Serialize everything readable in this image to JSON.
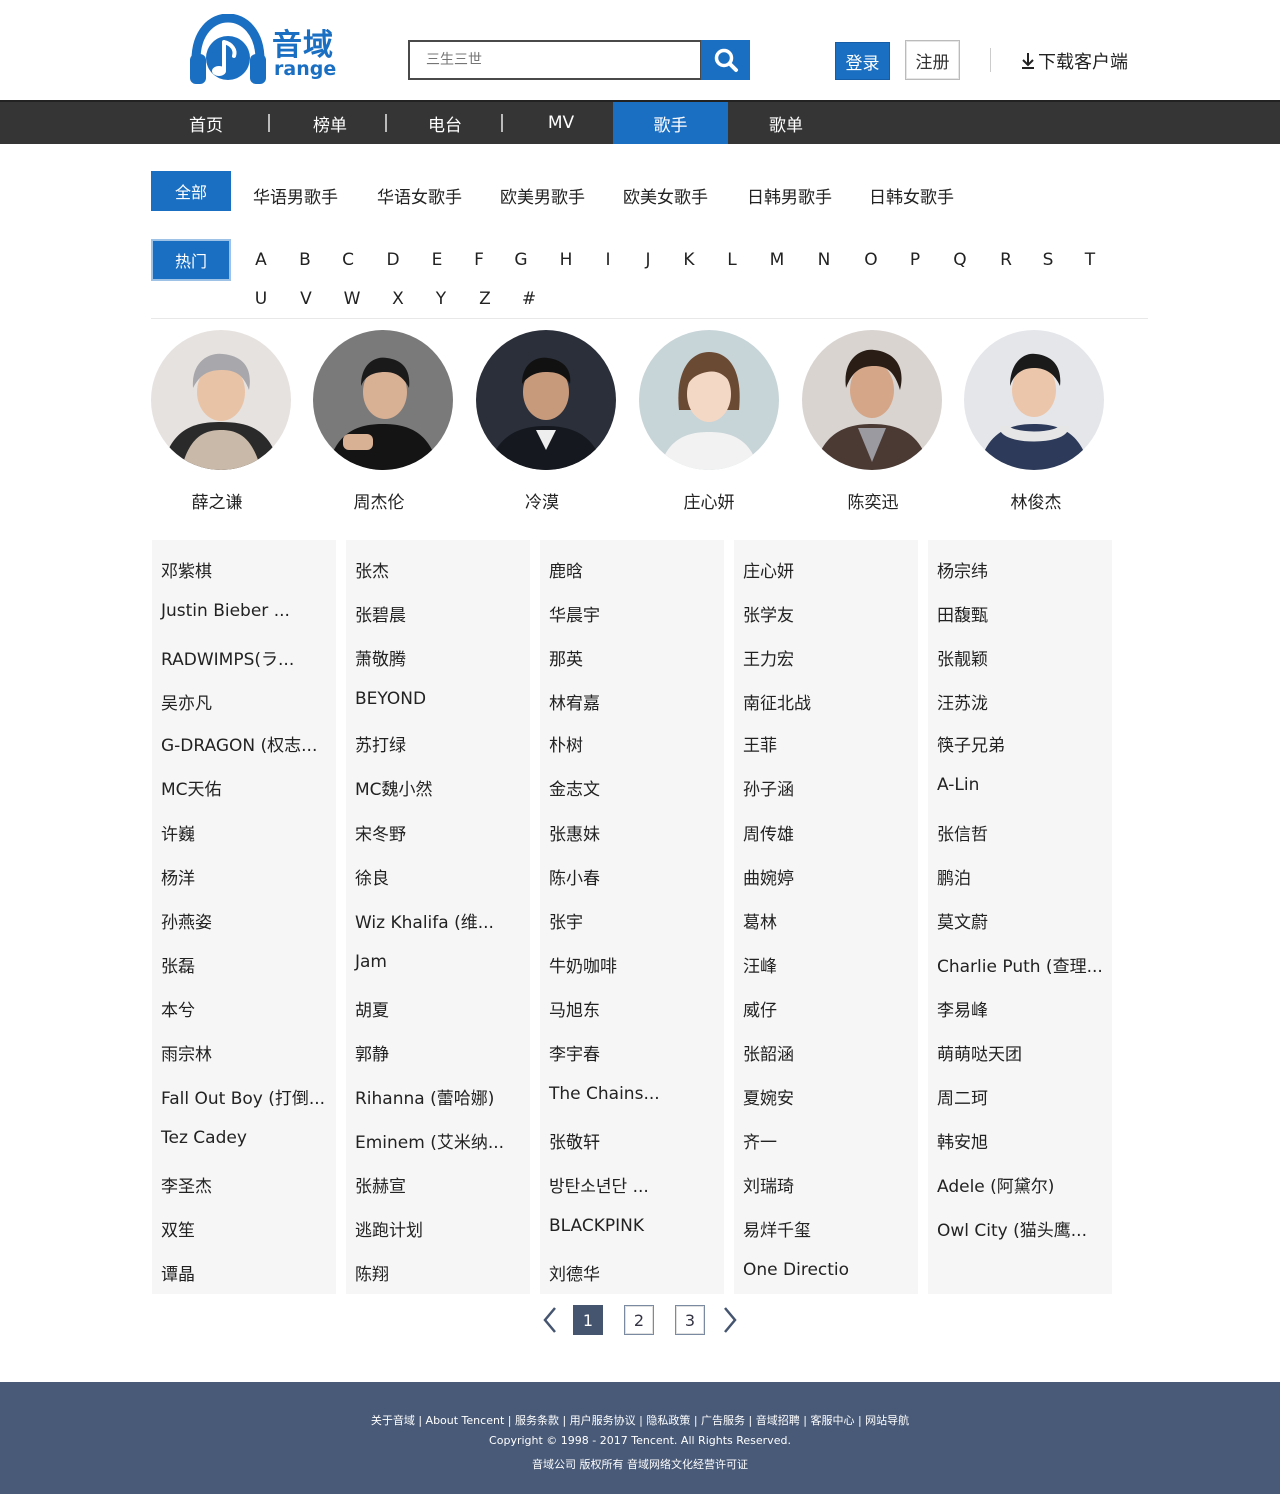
{
  "brand": {
    "name": "音域",
    "sub": "range",
    "colors": {
      "primary": "#1b6fc2",
      "nav": "#353535",
      "footer": "#485a78"
    }
  },
  "search": {
    "placeholder": "三生三世",
    "icon": "search-icon"
  },
  "auth": {
    "login": "登录",
    "register": "注册"
  },
  "download": {
    "label": "下载客户端",
    "icon": "download-icon"
  },
  "nav": {
    "items": [
      {
        "label": "首页"
      },
      {
        "label": "榜单"
      },
      {
        "label": "电台"
      },
      {
        "label": "MV"
      },
      {
        "label": "歌手",
        "active": true
      },
      {
        "label": "歌单"
      }
    ]
  },
  "categories": {
    "active": "全部",
    "items": [
      "华语男歌手",
      "华语女歌手",
      "欧美男歌手",
      "欧美女歌手",
      "日韩男歌手",
      "日韩女歌手"
    ]
  },
  "letters": {
    "hot": "热门",
    "row1": [
      "A",
      "B",
      "C",
      "D",
      "E",
      "F",
      "G",
      "H",
      "I",
      "J",
      "K",
      "L",
      "M",
      "N",
      "O",
      "P",
      "Q",
      "R",
      "S",
      "T"
    ],
    "row2": [
      "U",
      "V",
      "W",
      "X",
      "Y",
      "Z",
      "#"
    ]
  },
  "featured": [
    {
      "name": "薛之谦"
    },
    {
      "name": "周杰伦"
    },
    {
      "name": "冷漠"
    },
    {
      "name": "庄心妍"
    },
    {
      "name": "陈奕迅"
    },
    {
      "name": "林俊杰"
    }
  ],
  "singer_columns": [
    [
      "邓紫棋",
      "Justin Bieber ...",
      "RADWIMPS(ラ...",
      "吴亦凡",
      "G-DRAGON (权志...",
      "MC天佑",
      "许巍",
      "杨洋",
      "孙燕姿",
      "张磊",
      "本兮",
      "雨宗林",
      "Fall Out Boy (打倒...",
      "Tez Cadey",
      "李圣杰",
      "双笙",
      "谭晶"
    ],
    [
      "张杰",
      "张碧晨",
      "萧敬腾",
      "BEYOND",
      "苏打绿",
      "MC魏小然",
      "宋冬野",
      "徐良",
      "Wiz Khalifa (维...",
      "Jam",
      "胡夏",
      "郭静",
      "Rihanna (蕾哈娜)",
      "Eminem (艾米纳...",
      "张赫宣",
      "逃跑计划",
      "陈翔"
    ],
    [
      "鹿晗",
      "华晨宇",
      "那英",
      "林宥嘉",
      "朴树",
      "金志文",
      "张惠妹",
      "陈小春",
      "张宇",
      "牛奶咖啡",
      "马旭东",
      "李宇春",
      "The Chains...",
      "张敬轩",
      "방탄소년단 ...",
      "BLACKPINK",
      "刘德华"
    ],
    [
      "庄心妍",
      "张学友",
      "王力宏",
      "南征北战",
      "王菲",
      "孙子涵",
      "周传雄",
      "曲婉婷",
      "葛林",
      "汪峰",
      "威仔",
      "张韶涵",
      "夏婉安",
      "齐一",
      "刘瑞琦",
      "易烊千玺",
      "One Directio"
    ],
    [
      "杨宗纬",
      "田馥甄",
      "张靓颖",
      "汪苏泷",
      "筷子兄弟",
      "A-Lin",
      "张信哲",
      "鹏泊",
      "莫文蔚",
      "Charlie Puth (查理...",
      "李易峰",
      "萌萌哒天团",
      "周二珂",
      "韩安旭",
      "Adele (阿黛尔)",
      "Owl City (猫头鹰..."
    ]
  ],
  "pagination": {
    "pages": [
      "1",
      "2",
      "3"
    ],
    "current": "1"
  },
  "footer": {
    "links": "关于音域 | About Tencent | 服务条款 | 用户服务协议 | 隐私政策 | 广告服务 | 音域招聘 | 客服中心 | 网站导航",
    "copyright": "Copyright © 1998 - 2017 Tencent. All Rights Reserved.",
    "company": "音域公司 版权所有 音域网络文化经营许可证"
  }
}
